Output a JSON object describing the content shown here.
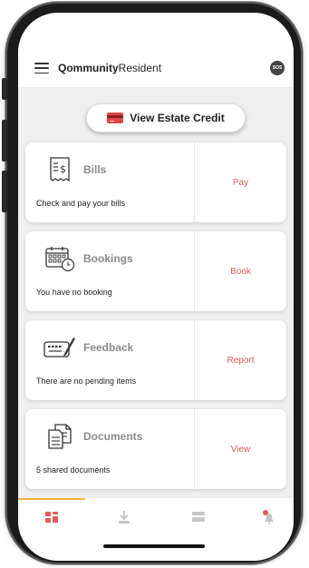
{
  "header": {
    "brand_bold": "Qommunity",
    "brand_rest": "Resident",
    "sos_label": "SOS"
  },
  "credit_button": {
    "label": "View Estate Credit"
  },
  "cards": [
    {
      "title": "Bills",
      "description": "Check and pay your bills",
      "action": "Pay",
      "icon": "receipt-dollar-icon"
    },
    {
      "title": "Bookings",
      "description": "You have no booking",
      "action": "Book",
      "icon": "calendar-clock-icon"
    },
    {
      "title": "Feedback",
      "description": "There are no pending items",
      "action": "Report",
      "icon": "keyboard-pen-icon"
    },
    {
      "title": "Documents",
      "description": "5 shared documents",
      "action": "View",
      "icon": "documents-icon"
    }
  ],
  "tabbar": {
    "tabs": [
      "dashboard-icon",
      "download-icon",
      "messages-icon",
      "notifications-icon"
    ],
    "active_color": "#e35b5b",
    "indicator_color": "#f2b339"
  },
  "colors": {
    "accent": "#e35b5b",
    "background": "#efefef"
  }
}
